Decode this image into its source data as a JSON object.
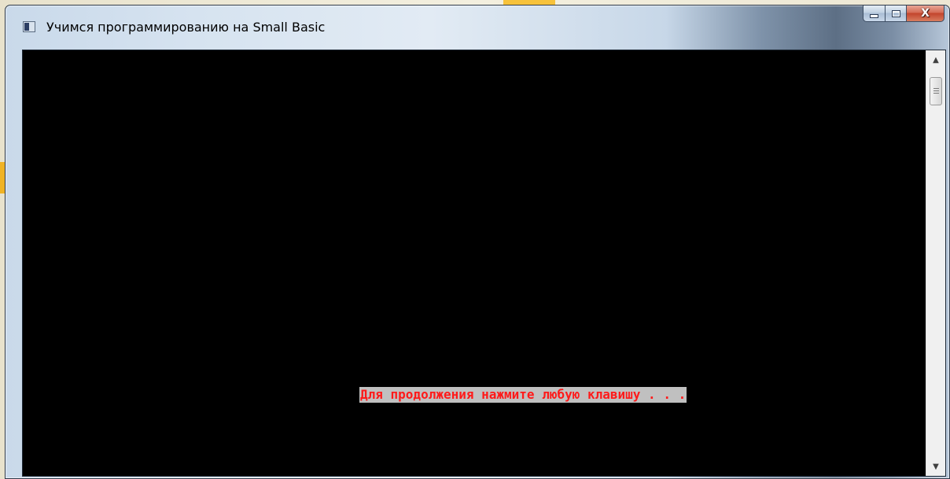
{
  "window": {
    "title": "Учимся программированию на Small Basic",
    "buttons": {
      "minimize": "minimize-icon",
      "maximize": "maximize-icon",
      "close": "close-icon",
      "close_glyph": "X"
    }
  },
  "console": {
    "background_color": "#000000",
    "prompt_text": "Для продолжения нажмите любую клавишу . . .",
    "prompt_text_color": "#ff1a1a",
    "prompt_background_color": "#c0c0c0"
  },
  "scrollbar": {
    "up_arrow": "▲",
    "down_arrow": "▼"
  }
}
